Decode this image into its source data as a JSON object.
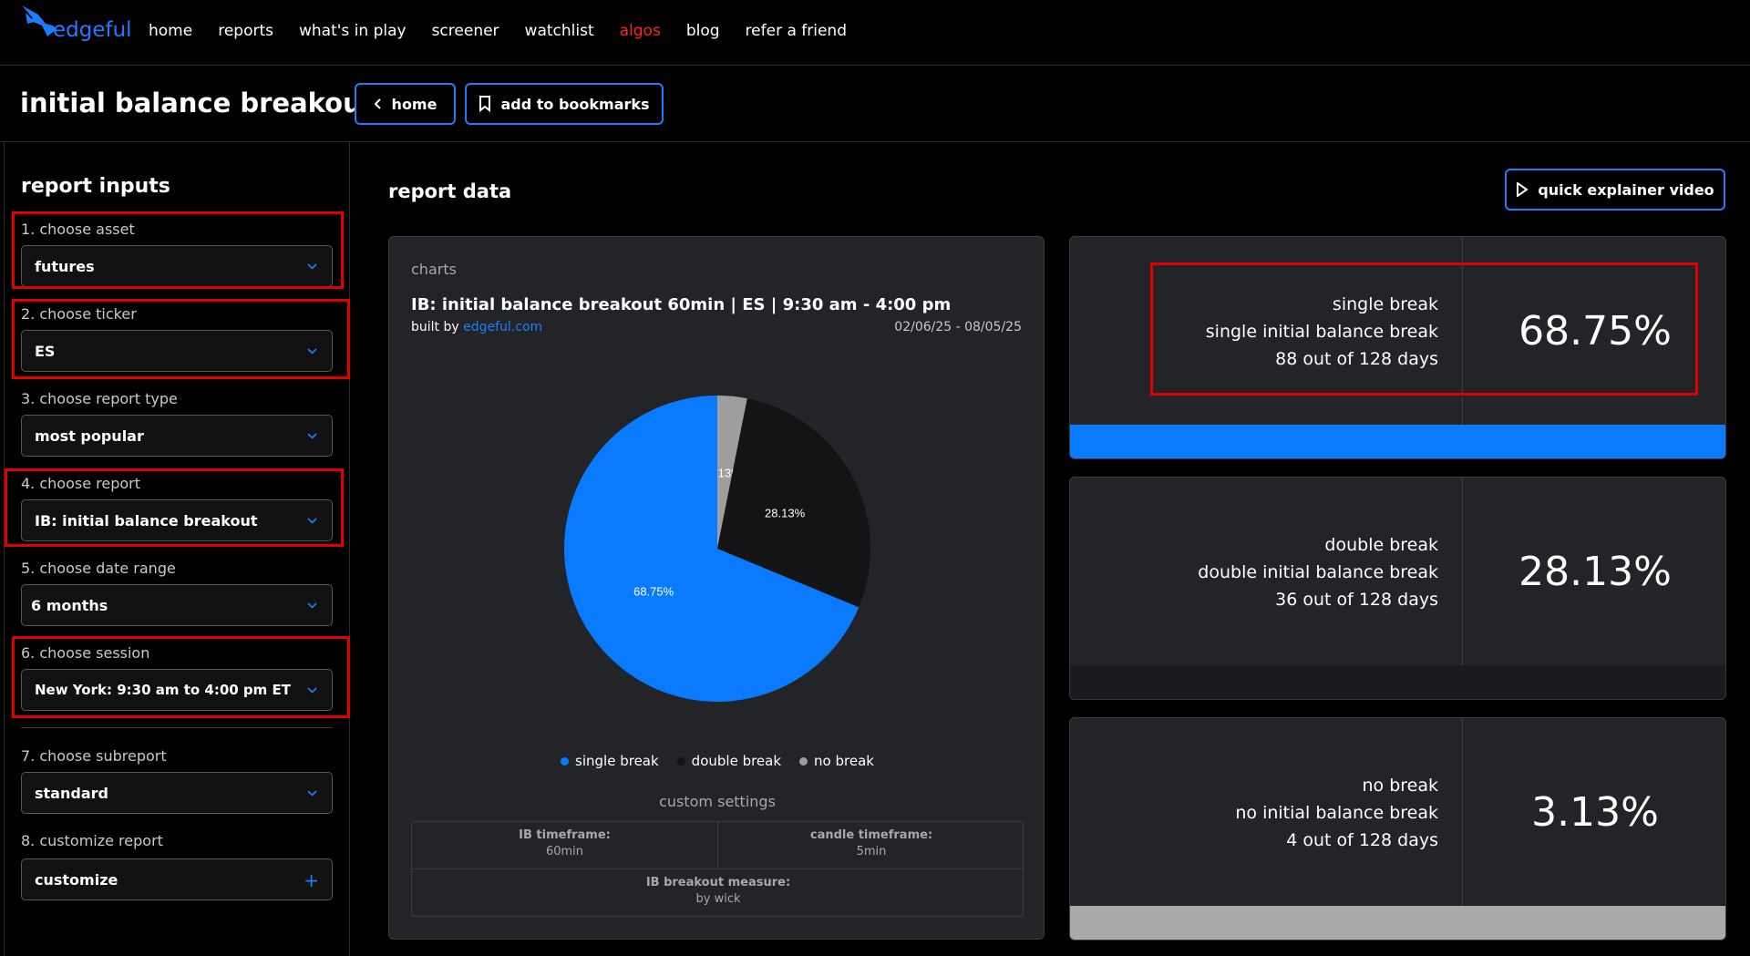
{
  "brand": {
    "name": "edgeful",
    "color": "#1e7cff"
  },
  "nav": {
    "items": [
      {
        "label": "home"
      },
      {
        "label": "reports"
      },
      {
        "label": "what's in play"
      },
      {
        "label": "screener"
      },
      {
        "label": "watchlist"
      },
      {
        "label": "algos",
        "highlight": "#ff2020"
      },
      {
        "label": "blog"
      },
      {
        "label": "refer a friend"
      }
    ]
  },
  "header": {
    "title": "initial balance breakout",
    "home_button": "home",
    "bookmark_button": "add to bookmarks"
  },
  "sidebar": {
    "title": "report inputs",
    "fields": [
      {
        "label": "1. choose asset",
        "value": "futures"
      },
      {
        "label": "2. choose ticker",
        "value": "ES"
      },
      {
        "label": "3. choose report type",
        "value": "most popular"
      },
      {
        "label": "4. choose report",
        "value": "IB: initial balance breakout"
      },
      {
        "label": "5. choose date range",
        "value": "6 months"
      },
      {
        "label": "6. choose session",
        "value": "New York: 9:30 am to 4:00 pm ET"
      },
      {
        "label": "7. choose subreport",
        "value": "standard"
      },
      {
        "label": "8. customize report",
        "value": "customize"
      }
    ]
  },
  "main": {
    "title": "report data",
    "video_button": "quick explainer video"
  },
  "chart_card": {
    "label": "charts",
    "title": "IB: initial balance breakout 60min | ES | 9:30 am - 4:00 pm",
    "built_by_prefix": "built by",
    "built_by_link": "edgeful.com",
    "date_range": "02/06/25 - 08/05/25",
    "custom_settings_title": "custom settings",
    "settings": {
      "ib_timeframe_label": "IB timeframe:",
      "ib_timeframe_value": "60min",
      "candle_timeframe_label": "candle timeframe:",
      "candle_timeframe_value": "5min",
      "breakout_measure_label": "IB breakout measure:",
      "breakout_measure_value": "by wick"
    }
  },
  "chart_data": {
    "type": "pie",
    "slices": [
      {
        "name": "no break",
        "value": 3.13,
        "label": "3.13%",
        "color": "#9e9e9e"
      },
      {
        "name": "double break",
        "value": 28.13,
        "label": "28.13%",
        "color": "#141416"
      },
      {
        "name": "single break",
        "value": 68.75,
        "label": "68.75%",
        "color": "#0a7bff"
      }
    ],
    "legend": [
      "single break",
      "double break",
      "no break"
    ],
    "legend_position": "bottom"
  },
  "stats": [
    {
      "title": "single break",
      "subtitle": "single initial balance break",
      "days": "88 out of 128 days",
      "pct": "68.75%",
      "bar_color": "#0a7bff"
    },
    {
      "title": "double break",
      "subtitle": "double initial balance break",
      "days": "36 out of 128 days",
      "pct": "28.13%",
      "bar_color": "#1a1b1e"
    },
    {
      "title": "no break",
      "subtitle": "no initial balance break",
      "days": "4 out of 128 days",
      "pct": "3.13%",
      "bar_color": "#a9a9a9"
    }
  ]
}
